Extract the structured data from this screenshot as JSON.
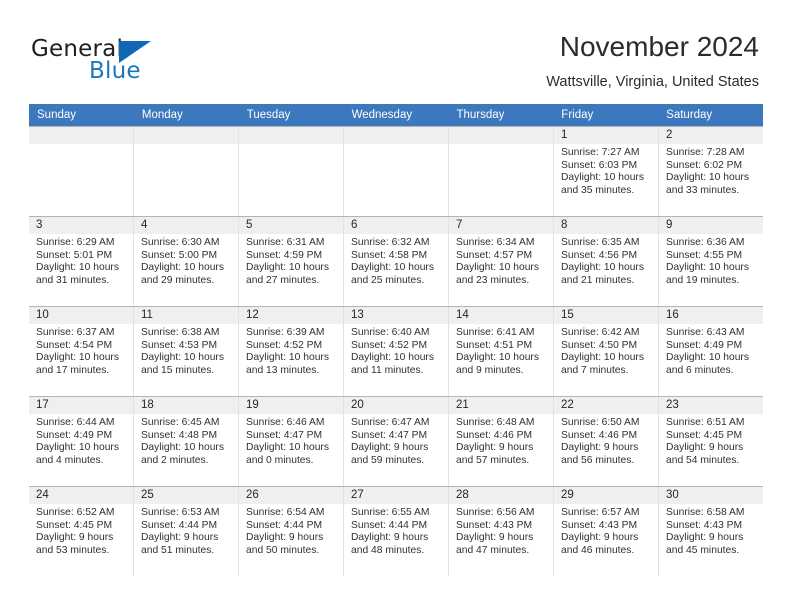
{
  "brand": {
    "word_one": "General",
    "word_two": "Blue",
    "accent_color": "#1068b4"
  },
  "header": {
    "title": "November 2024",
    "location": "Wattsville, Virginia, United States",
    "header_bg": "#3b78bd"
  },
  "weekdays": [
    "Sunday",
    "Monday",
    "Tuesday",
    "Wednesday",
    "Thursday",
    "Friday",
    "Saturday"
  ],
  "weeks": [
    [
      {
        "day": "",
        "sunrise": "",
        "sunset": "",
        "daylight_line1": "",
        "daylight_line2": "",
        "empty": true
      },
      {
        "day": "",
        "sunrise": "",
        "sunset": "",
        "daylight_line1": "",
        "daylight_line2": "",
        "empty": true
      },
      {
        "day": "",
        "sunrise": "",
        "sunset": "",
        "daylight_line1": "",
        "daylight_line2": "",
        "empty": true
      },
      {
        "day": "",
        "sunrise": "",
        "sunset": "",
        "daylight_line1": "",
        "daylight_line2": "",
        "empty": true
      },
      {
        "day": "",
        "sunrise": "",
        "sunset": "",
        "daylight_line1": "",
        "daylight_line2": "",
        "empty": true
      },
      {
        "day": "1",
        "sunrise": "Sunrise: 7:27 AM",
        "sunset": "Sunset: 6:03 PM",
        "daylight_line1": "Daylight: 10 hours",
        "daylight_line2": "and 35 minutes."
      },
      {
        "day": "2",
        "sunrise": "Sunrise: 7:28 AM",
        "sunset": "Sunset: 6:02 PM",
        "daylight_line1": "Daylight: 10 hours",
        "daylight_line2": "and 33 minutes."
      }
    ],
    [
      {
        "day": "3",
        "sunrise": "Sunrise: 6:29 AM",
        "sunset": "Sunset: 5:01 PM",
        "daylight_line1": "Daylight: 10 hours",
        "daylight_line2": "and 31 minutes."
      },
      {
        "day": "4",
        "sunrise": "Sunrise: 6:30 AM",
        "sunset": "Sunset: 5:00 PM",
        "daylight_line1": "Daylight: 10 hours",
        "daylight_line2": "and 29 minutes."
      },
      {
        "day": "5",
        "sunrise": "Sunrise: 6:31 AM",
        "sunset": "Sunset: 4:59 PM",
        "daylight_line1": "Daylight: 10 hours",
        "daylight_line2": "and 27 minutes."
      },
      {
        "day": "6",
        "sunrise": "Sunrise: 6:32 AM",
        "sunset": "Sunset: 4:58 PM",
        "daylight_line1": "Daylight: 10 hours",
        "daylight_line2": "and 25 minutes."
      },
      {
        "day": "7",
        "sunrise": "Sunrise: 6:34 AM",
        "sunset": "Sunset: 4:57 PM",
        "daylight_line1": "Daylight: 10 hours",
        "daylight_line2": "and 23 minutes."
      },
      {
        "day": "8",
        "sunrise": "Sunrise: 6:35 AM",
        "sunset": "Sunset: 4:56 PM",
        "daylight_line1": "Daylight: 10 hours",
        "daylight_line2": "and 21 minutes."
      },
      {
        "day": "9",
        "sunrise": "Sunrise: 6:36 AM",
        "sunset": "Sunset: 4:55 PM",
        "daylight_line1": "Daylight: 10 hours",
        "daylight_line2": "and 19 minutes."
      }
    ],
    [
      {
        "day": "10",
        "sunrise": "Sunrise: 6:37 AM",
        "sunset": "Sunset: 4:54 PM",
        "daylight_line1": "Daylight: 10 hours",
        "daylight_line2": "and 17 minutes."
      },
      {
        "day": "11",
        "sunrise": "Sunrise: 6:38 AM",
        "sunset": "Sunset: 4:53 PM",
        "daylight_line1": "Daylight: 10 hours",
        "daylight_line2": "and 15 minutes."
      },
      {
        "day": "12",
        "sunrise": "Sunrise: 6:39 AM",
        "sunset": "Sunset: 4:52 PM",
        "daylight_line1": "Daylight: 10 hours",
        "daylight_line2": "and 13 minutes."
      },
      {
        "day": "13",
        "sunrise": "Sunrise: 6:40 AM",
        "sunset": "Sunset: 4:52 PM",
        "daylight_line1": "Daylight: 10 hours",
        "daylight_line2": "and 11 minutes."
      },
      {
        "day": "14",
        "sunrise": "Sunrise: 6:41 AM",
        "sunset": "Sunset: 4:51 PM",
        "daylight_line1": "Daylight: 10 hours",
        "daylight_line2": "and 9 minutes."
      },
      {
        "day": "15",
        "sunrise": "Sunrise: 6:42 AM",
        "sunset": "Sunset: 4:50 PM",
        "daylight_line1": "Daylight: 10 hours",
        "daylight_line2": "and 7 minutes."
      },
      {
        "day": "16",
        "sunrise": "Sunrise: 6:43 AM",
        "sunset": "Sunset: 4:49 PM",
        "daylight_line1": "Daylight: 10 hours",
        "daylight_line2": "and 6 minutes."
      }
    ],
    [
      {
        "day": "17",
        "sunrise": "Sunrise: 6:44 AM",
        "sunset": "Sunset: 4:49 PM",
        "daylight_line1": "Daylight: 10 hours",
        "daylight_line2": "and 4 minutes."
      },
      {
        "day": "18",
        "sunrise": "Sunrise: 6:45 AM",
        "sunset": "Sunset: 4:48 PM",
        "daylight_line1": "Daylight: 10 hours",
        "daylight_line2": "and 2 minutes."
      },
      {
        "day": "19",
        "sunrise": "Sunrise: 6:46 AM",
        "sunset": "Sunset: 4:47 PM",
        "daylight_line1": "Daylight: 10 hours",
        "daylight_line2": "and 0 minutes."
      },
      {
        "day": "20",
        "sunrise": "Sunrise: 6:47 AM",
        "sunset": "Sunset: 4:47 PM",
        "daylight_line1": "Daylight: 9 hours",
        "daylight_line2": "and 59 minutes."
      },
      {
        "day": "21",
        "sunrise": "Sunrise: 6:48 AM",
        "sunset": "Sunset: 4:46 PM",
        "daylight_line1": "Daylight: 9 hours",
        "daylight_line2": "and 57 minutes."
      },
      {
        "day": "22",
        "sunrise": "Sunrise: 6:50 AM",
        "sunset": "Sunset: 4:46 PM",
        "daylight_line1": "Daylight: 9 hours",
        "daylight_line2": "and 56 minutes."
      },
      {
        "day": "23",
        "sunrise": "Sunrise: 6:51 AM",
        "sunset": "Sunset: 4:45 PM",
        "daylight_line1": "Daylight: 9 hours",
        "daylight_line2": "and 54 minutes."
      }
    ],
    [
      {
        "day": "24",
        "sunrise": "Sunrise: 6:52 AM",
        "sunset": "Sunset: 4:45 PM",
        "daylight_line1": "Daylight: 9 hours",
        "daylight_line2": "and 53 minutes."
      },
      {
        "day": "25",
        "sunrise": "Sunrise: 6:53 AM",
        "sunset": "Sunset: 4:44 PM",
        "daylight_line1": "Daylight: 9 hours",
        "daylight_line2": "and 51 minutes."
      },
      {
        "day": "26",
        "sunrise": "Sunrise: 6:54 AM",
        "sunset": "Sunset: 4:44 PM",
        "daylight_line1": "Daylight: 9 hours",
        "daylight_line2": "and 50 minutes."
      },
      {
        "day": "27",
        "sunrise": "Sunrise: 6:55 AM",
        "sunset": "Sunset: 4:44 PM",
        "daylight_line1": "Daylight: 9 hours",
        "daylight_line2": "and 48 minutes."
      },
      {
        "day": "28",
        "sunrise": "Sunrise: 6:56 AM",
        "sunset": "Sunset: 4:43 PM",
        "daylight_line1": "Daylight: 9 hours",
        "daylight_line2": "and 47 minutes."
      },
      {
        "day": "29",
        "sunrise": "Sunrise: 6:57 AM",
        "sunset": "Sunset: 4:43 PM",
        "daylight_line1": "Daylight: 9 hours",
        "daylight_line2": "and 46 minutes."
      },
      {
        "day": "30",
        "sunrise": "Sunrise: 6:58 AM",
        "sunset": "Sunset: 4:43 PM",
        "daylight_line1": "Daylight: 9 hours",
        "daylight_line2": "and 45 minutes."
      }
    ]
  ]
}
